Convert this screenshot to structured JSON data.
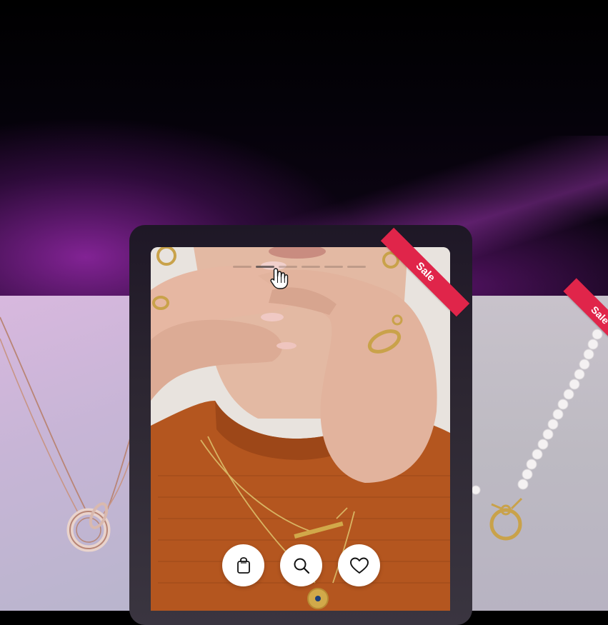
{
  "product_card": {
    "badge": "Sale"
  },
  "side_card_right": {
    "badge": "Sale"
  },
  "slider": {
    "dot_count": 6,
    "active_index": 1
  },
  "actions": [
    {
      "name": "add-to-cart",
      "icon": "shopping-bag-icon"
    },
    {
      "name": "quick-view",
      "icon": "search-icon"
    },
    {
      "name": "wishlist",
      "icon": "heart-icon"
    }
  ],
  "colors": {
    "sale_badge": "#e0254a",
    "gold": "#c9a24a",
    "rose_gold": "#b07a6a",
    "sweater": "#b4561f"
  }
}
